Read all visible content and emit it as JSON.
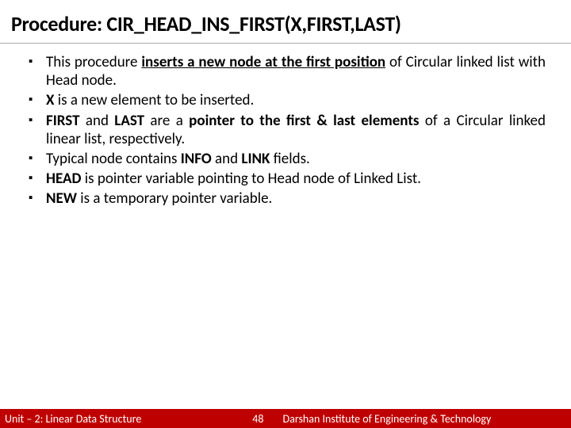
{
  "title": "Procedure: CIR_HEAD_INS_FIRST(X,FIRST,LAST)",
  "bullets": [
    {
      "pre": "This procedure ",
      "u": "inserts a new node at the first position",
      "post": " of Circular linked list with Head node."
    },
    {
      "html": "<b>X</b> is a new element to be inserted."
    },
    {
      "html": "<b>FIRST</b> and <b>LAST</b> are a <b>pointer to the first &amp; last elements</b> of a Circular linked linear list, respectively."
    },
    {
      "html": "Typical node contains <b>INFO</b> and <b>LINK</b> fields."
    },
    {
      "html": "<b>HEAD</b> is pointer variable pointing to Head node of Linked List."
    },
    {
      "html": "<b>NEW</b> is a temporary pointer variable."
    }
  ],
  "footer": {
    "left": "Unit – 2: Linear Data Structure",
    "page": "48",
    "right": "Darshan Institute of Engineering & Technology"
  }
}
